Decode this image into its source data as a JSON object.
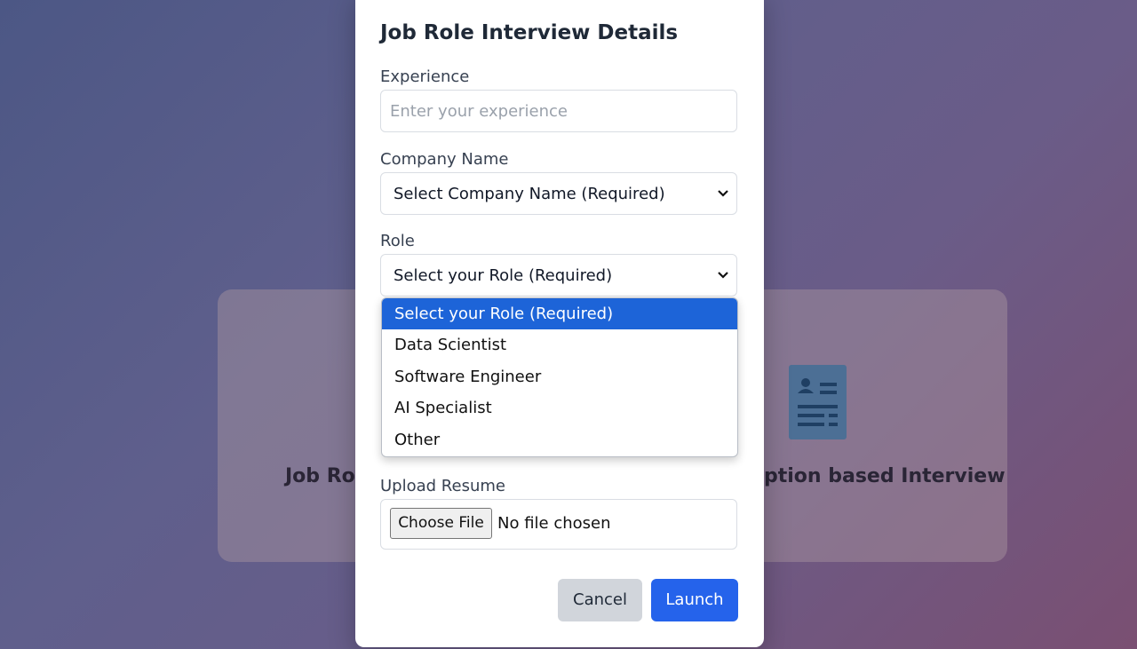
{
  "background": {
    "left_card_title": "Job Rol",
    "right_card_title": "ption based Interview",
    "right_card_icon": "resume-document-icon"
  },
  "modal": {
    "title": "Job Role Interview Details",
    "experience": {
      "label": "Experience",
      "placeholder": "Enter your experience",
      "value": ""
    },
    "company": {
      "label": "Company Name",
      "selected": "Select Company Name (Required)"
    },
    "role": {
      "label": "Role",
      "selected": "Select your Role (Required)",
      "options": [
        "Select your Role (Required)",
        "Data Scientist",
        "Software Engineer",
        "AI Specialist",
        "Other"
      ],
      "highlighted_index": 0
    },
    "resume": {
      "label": "Upload Resume",
      "button_label": "Choose File",
      "status": "No file chosen"
    },
    "actions": {
      "cancel_label": "Cancel",
      "launch_label": "Launch"
    }
  },
  "colors": {
    "primary": "#2563eb",
    "highlight": "#1d64d8",
    "cancel_bg": "#d1d5db"
  }
}
